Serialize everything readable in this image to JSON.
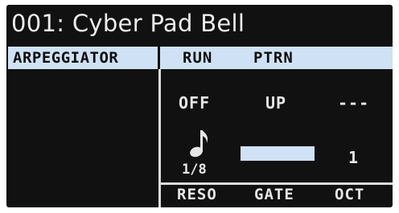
{
  "display": {
    "title": "001: Cyber Pad Bell",
    "category_tab": "ARPEGGIATOR"
  },
  "top_params": {
    "run_label": "RUN",
    "ptrn_label": "PTRN"
  },
  "values": {
    "run": "OFF",
    "ptrn": "UP",
    "third": "---",
    "rate": "1/8",
    "gate_fill": 1.0,
    "oct": "1"
  },
  "bottom_params": {
    "reso_label": "RESO",
    "gate_label": "GATE",
    "oct_label": "OCT"
  },
  "icons": {
    "rate_icon": "eighth-note-icon"
  },
  "colors": {
    "screen_bg": "#111111",
    "highlight": "#cfe2f5",
    "text": "#e6e6e6"
  }
}
